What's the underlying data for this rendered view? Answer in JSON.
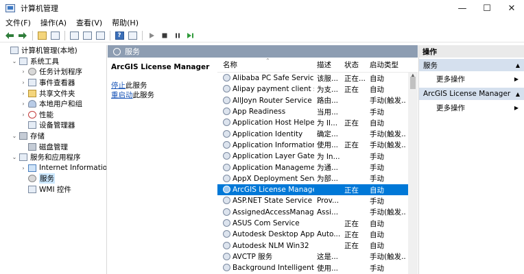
{
  "window": {
    "title": "计算机管理",
    "min": "—",
    "max": "☐",
    "close": "✕"
  },
  "menu": [
    "文件(F)",
    "操作(A)",
    "查看(V)",
    "帮助(H)"
  ],
  "toolbar": {
    "back": "🡐",
    "forward": "🡒",
    "help": "?",
    "play": "▶",
    "stop": "■",
    "pause": "❚❚",
    "restart": "▶❚"
  },
  "tree": [
    {
      "label": "计算机管理(本地)",
      "twisty": "",
      "icon": "computer",
      "indent": 0,
      "selected": false
    },
    {
      "label": "系统工具",
      "twisty": "⌄",
      "icon": "tools",
      "indent": 1,
      "selected": false
    },
    {
      "label": "任务计划程序",
      "twisty": "›",
      "icon": "clock",
      "indent": 2,
      "selected": false
    },
    {
      "label": "事件查看器",
      "twisty": "›",
      "icon": "event",
      "indent": 2,
      "selected": false
    },
    {
      "label": "共享文件夹",
      "twisty": "›",
      "icon": "folder",
      "indent": 2,
      "selected": false
    },
    {
      "label": "本地用户和组",
      "twisty": "›",
      "icon": "users",
      "indent": 2,
      "selected": false
    },
    {
      "label": "性能",
      "twisty": "›",
      "icon": "perf",
      "indent": 2,
      "selected": false
    },
    {
      "label": "设备管理器",
      "twisty": "",
      "icon": "device",
      "indent": 2,
      "selected": false
    },
    {
      "label": "存储",
      "twisty": "⌄",
      "icon": "storage",
      "indent": 1,
      "selected": false
    },
    {
      "label": "磁盘管理",
      "twisty": "",
      "icon": "disk",
      "indent": 2,
      "selected": false
    },
    {
      "label": "服务和应用程序",
      "twisty": "⌄",
      "icon": "services-apps",
      "indent": 1,
      "selected": false
    },
    {
      "label": "Internet Information S",
      "twisty": "›",
      "icon": "net",
      "indent": 2,
      "selected": false
    },
    {
      "label": "服务",
      "twisty": "",
      "icon": "gear",
      "indent": 2,
      "selected": true
    },
    {
      "label": "WMI 控件",
      "twisty": "",
      "icon": "wmi",
      "indent": 2,
      "selected": false
    }
  ],
  "middle": {
    "header": "服务",
    "title": "ArcGIS License Manager",
    "stop_link": "停止",
    "stop_rest": "此服务",
    "restart_link": "重启动",
    "restart_rest": "此服务"
  },
  "columns": {
    "name": "名称",
    "desc": "描述",
    "status": "状态",
    "startup": "启动类型"
  },
  "services": [
    {
      "name": "Alibaba PC Safe Service",
      "desc": "该服...",
      "status": "正在...",
      "startup": "自动"
    },
    {
      "name": "Alipay payment client sec...",
      "desc": "为支...",
      "status": "正在",
      "startup": "自动"
    },
    {
      "name": "AllJoyn Router Service",
      "desc": "路由...",
      "status": "",
      "startup": "手动(触发..."
    },
    {
      "name": "App Readiness",
      "desc": "当用...",
      "status": "",
      "startup": "手动"
    },
    {
      "name": "Application Host Helper ...",
      "desc": "为 II...",
      "status": "正在",
      "startup": "自动"
    },
    {
      "name": "Application Identity",
      "desc": "确定...",
      "status": "",
      "startup": "手动(触发..."
    },
    {
      "name": "Application Information",
      "desc": "使用...",
      "status": "正在",
      "startup": "手动(触发..."
    },
    {
      "name": "Application Layer Gatewa...",
      "desc": "为 In...",
      "status": "",
      "startup": "手动"
    },
    {
      "name": "Application Management",
      "desc": "为通...",
      "status": "",
      "startup": "手动"
    },
    {
      "name": "AppX Deployment Servic...",
      "desc": "为部...",
      "status": "",
      "startup": "手动"
    },
    {
      "name": "ArcGIS License Manager",
      "desc": "",
      "status": "正在",
      "startup": "自动",
      "selected": true
    },
    {
      "name": "ASP.NET State Service",
      "desc": "Prov...",
      "status": "",
      "startup": "手动"
    },
    {
      "name": "AssignedAccessManager",
      "desc": "Assi...",
      "status": "",
      "startup": "手动(触发..."
    },
    {
      "name": "ASUS Com Service",
      "desc": "",
      "status": "正在",
      "startup": "自动"
    },
    {
      "name": "Autodesk Desktop App S...",
      "desc": "Auto...",
      "status": "正在",
      "startup": "自动"
    },
    {
      "name": "Autodesk NLM Win32",
      "desc": "",
      "status": "正在",
      "startup": "自动"
    },
    {
      "name": "AVCTP 服务",
      "desc": "这是...",
      "status": "",
      "startup": "手动(触发..."
    },
    {
      "name": "Background Intelligent T...",
      "desc": "使用...",
      "status": "",
      "startup": "手动"
    }
  ],
  "actions": {
    "title": "操作",
    "sections": [
      {
        "label": "服务",
        "arrow": "▲",
        "items": [
          {
            "label": "更多操作",
            "arrow": "▶"
          }
        ]
      },
      {
        "label": "ArcGIS License Manager",
        "arrow": "▲",
        "items": [
          {
            "label": "更多操作",
            "arrow": "▶"
          }
        ]
      }
    ]
  },
  "colors": {
    "selection": "#0078d7",
    "header_band": "#8d9db2",
    "action_section": "#d5e0ee",
    "link": "#1a56b8"
  }
}
